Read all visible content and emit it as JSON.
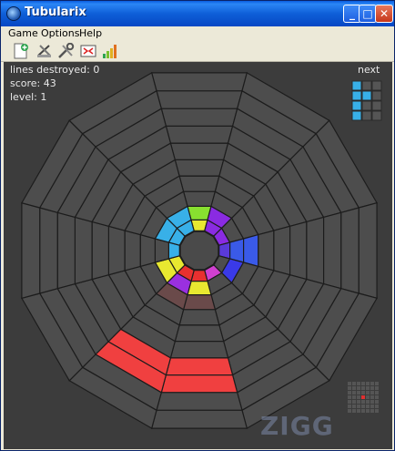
{
  "window": {
    "title": "Tubularix",
    "minimize_label": "_",
    "maximize_label": "□",
    "close_label": "✕"
  },
  "menu": {
    "items": [
      "Game",
      "Options",
      "Help"
    ]
  },
  "toolbar": {
    "buttons": [
      "new-game-icon",
      "pause-icon",
      "settings-icon",
      "high-scores-icon",
      "difficulty-icon"
    ]
  },
  "hud": {
    "lines_destroyed": "lines destroyed: 0",
    "score": "score: 43",
    "level": "level: 1",
    "next_label": "next"
  },
  "board": {
    "sectors": 12,
    "rings": 10,
    "colors": {
      "background": "#3c3c3c",
      "cell": "#4d4d4d",
      "grid": "#1c1c1c"
    },
    "filled_cells": [
      {
        "sector": 0,
        "ring": 0,
        "color": "#e8e830"
      },
      {
        "sector": 0,
        "ring": 1,
        "color": "#88e030"
      },
      {
        "sector": 1,
        "ring": 0,
        "color": "#8a2be2"
      },
      {
        "sector": 1,
        "ring": 1,
        "color": "#8a2be2"
      },
      {
        "sector": 2,
        "ring": 0,
        "color": "#8a2be2"
      },
      {
        "sector": 3,
        "ring": 0,
        "color": "#5a3ad8"
      },
      {
        "sector": 3,
        "ring": 1,
        "color": "#3a5ae8"
      },
      {
        "sector": 3,
        "ring": 2,
        "color": "#3a5ae8"
      },
      {
        "sector": 4,
        "ring": 1,
        "color": "#3a3ae8"
      },
      {
        "sector": 5,
        "ring": 0,
        "color": "#d040d0"
      },
      {
        "sector": 6,
        "ring": 0,
        "color": "#e83030"
      },
      {
        "sector": 6,
        "ring": 1,
        "color": "#e8e830"
      },
      {
        "sector": 6,
        "ring": 2,
        "color": "#6a4a4a"
      },
      {
        "sector": 6,
        "ring": 6,
        "color": "#f04040"
      },
      {
        "sector": 6,
        "ring": 7,
        "color": "#f04040"
      },
      {
        "sector": 7,
        "ring": 0,
        "color": "#e83030"
      },
      {
        "sector": 7,
        "ring": 1,
        "color": "#9a30e0"
      },
      {
        "sector": 7,
        "ring": 2,
        "color": "#6a4a4a"
      },
      {
        "sector": 7,
        "ring": 6,
        "color": "#f04040"
      },
      {
        "sector": 7,
        "ring": 7,
        "color": "#f04040"
      },
      {
        "sector": 8,
        "ring": 0,
        "color": "#e8e830"
      },
      {
        "sector": 8,
        "ring": 1,
        "color": "#e8e830"
      },
      {
        "sector": 9,
        "ring": 0,
        "color": "#38b0e8"
      },
      {
        "sector": 10,
        "ring": 0,
        "color": "#38b0e8"
      },
      {
        "sector": 10,
        "ring": 1,
        "color": "#38b0e8"
      },
      {
        "sector": 11,
        "ring": 0,
        "color": "#38b0e8"
      },
      {
        "sector": 11,
        "ring": 1,
        "color": "#38b0e8"
      }
    ]
  },
  "next_piece": {
    "cols": 3,
    "rows": 4,
    "filled": [
      [
        0,
        0
      ],
      [
        0,
        1
      ],
      [
        1,
        1
      ],
      [
        0,
        2
      ],
      [
        0,
        3
      ]
    ],
    "colors": {
      "on": "#38b0e8",
      "off": "#555555"
    }
  },
  "minimap": {
    "cols": 7,
    "rows": 7,
    "marker": [
      3,
      3
    ],
    "colors": {
      "on": "#e03030",
      "off": "#555555"
    }
  },
  "watermark": "ZIGG"
}
